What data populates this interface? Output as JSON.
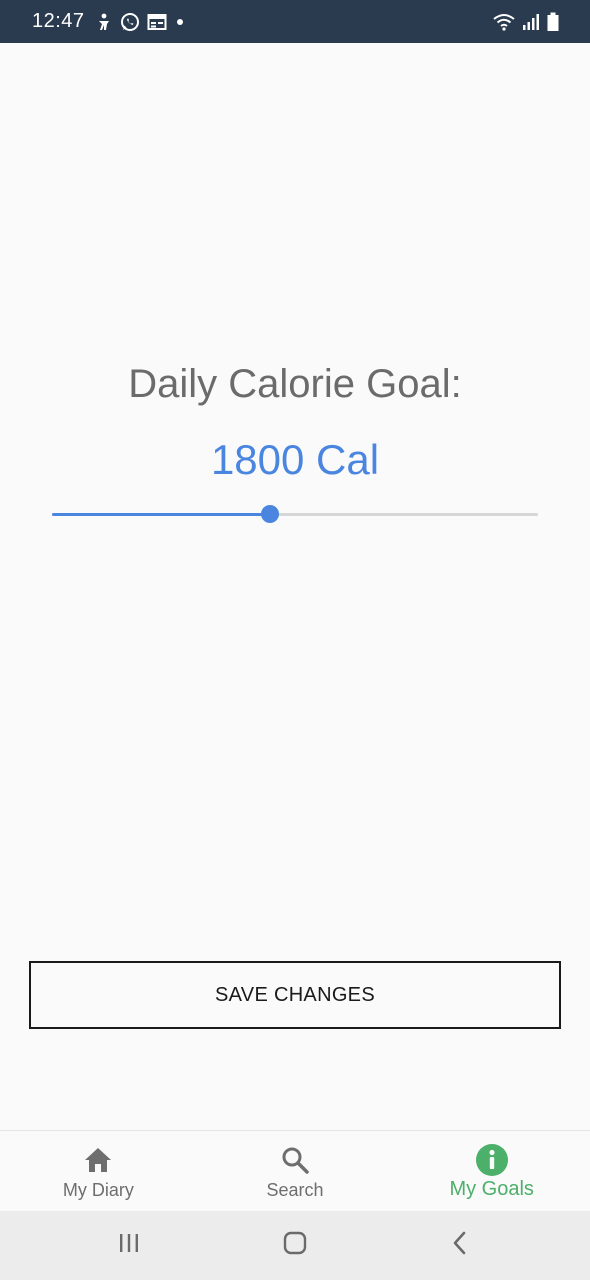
{
  "status_bar": {
    "time": "12:47",
    "left_icons": [
      "accessibility-icon",
      "whatsapp-icon",
      "calendar-icon",
      "notification-dot-icon"
    ],
    "right_icons": [
      "wifi-icon",
      "cellular-signal-icon",
      "battery-icon"
    ]
  },
  "goal": {
    "title": "Daily Calorie Goal:",
    "value_label": "1800 Cal",
    "slider_fraction": 0.448
  },
  "actions": {
    "save_label": "SAVE CHANGES"
  },
  "bottom_nav": {
    "items": [
      {
        "label": "My Diary",
        "icon": "home-icon",
        "active": false
      },
      {
        "label": "Search",
        "icon": "search-icon",
        "active": false
      },
      {
        "label": "My Goals",
        "icon": "info-icon",
        "active": true
      }
    ]
  },
  "system_nav": {
    "buttons": [
      "recent-apps-icon",
      "home-button-icon",
      "back-icon"
    ]
  },
  "colors": {
    "accent_blue": "#4a86e0",
    "active_green": "#4caf6a",
    "status_bar_bg": "#2b3b4f",
    "text_gray": "#6b6b6b"
  }
}
